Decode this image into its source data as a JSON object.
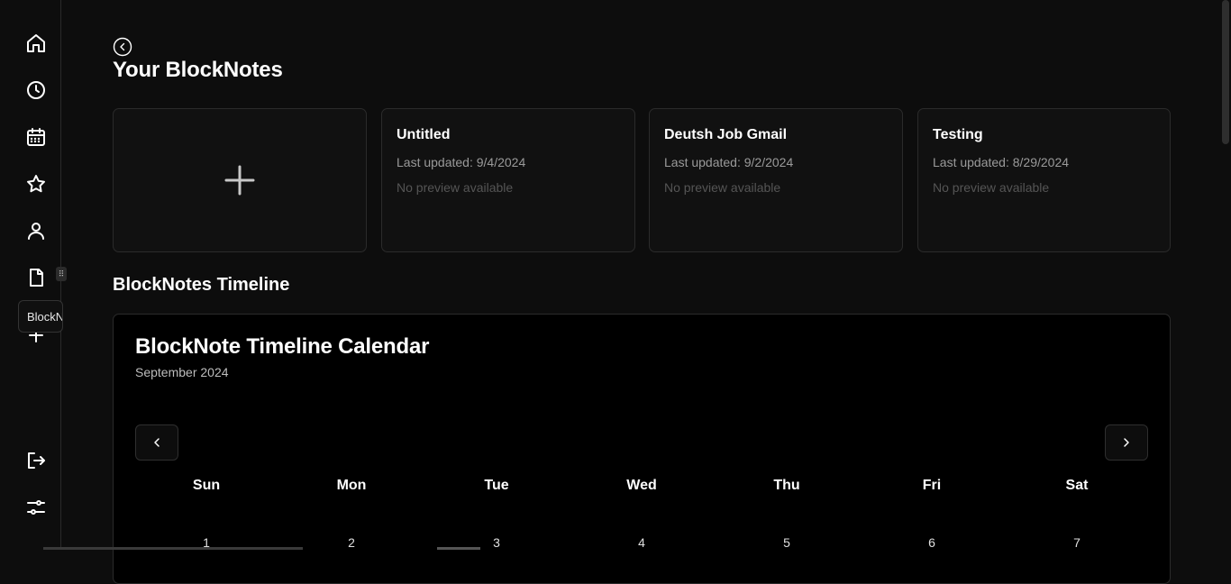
{
  "sidebar": {
    "items": [
      {
        "icon": "home-icon"
      },
      {
        "icon": "clock-icon"
      },
      {
        "icon": "calendar-icon"
      },
      {
        "icon": "star-icon"
      },
      {
        "icon": "user-icon"
      },
      {
        "icon": "document-icon"
      },
      {
        "icon": "plus-icon"
      }
    ],
    "tooltip": "BlockNotes",
    "bottom": [
      {
        "icon": "logout-icon"
      },
      {
        "icon": "sliders-icon"
      }
    ]
  },
  "header": {
    "title": "Your BlockNotes"
  },
  "notes": [
    {
      "title": "Untitled",
      "updated": "Last updated: 9/4/2024",
      "preview": "No preview available"
    },
    {
      "title": "Deutsh Job Gmail",
      "updated": "Last updated: 9/2/2024",
      "preview": "No preview available"
    },
    {
      "title": "Testing",
      "updated": "Last updated: 8/29/2024",
      "preview": "No preview available"
    }
  ],
  "timeline": {
    "section_title": "BlockNotes Timeline",
    "calendar_title": "BlockNote Timeline Calendar",
    "month": "September 2024",
    "weekdays": [
      "Sun",
      "Mon",
      "Tue",
      "Wed",
      "Thu",
      "Fri",
      "Sat"
    ],
    "days": [
      "1",
      "2",
      "3",
      "4",
      "5",
      "6",
      "7"
    ]
  },
  "colors": {
    "background": "#0d0d0d",
    "card": "#111111",
    "calendar": "#000000",
    "border": "#2b2b2b",
    "muted": "#9a9a9a",
    "faint": "#555555"
  }
}
